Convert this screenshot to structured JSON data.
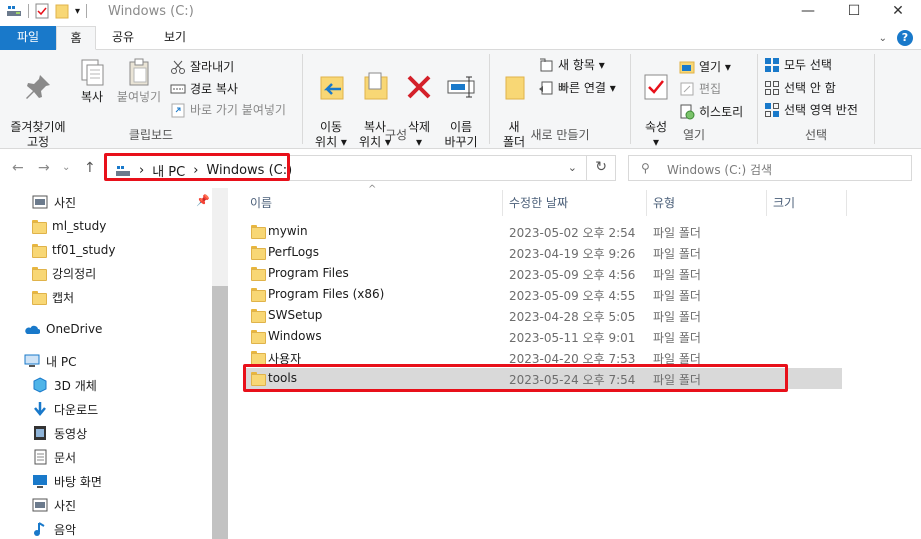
{
  "window": {
    "title": "Windows  (C:)",
    "controls": [
      "—",
      "☐",
      "✕"
    ]
  },
  "ribbon_tabs": [
    "파일",
    "홈",
    "공유",
    "보기"
  ],
  "ribbon": {
    "clipboard": {
      "pin": "즐겨찾기에\n고정",
      "copy": "복사",
      "paste": "붙여넣기",
      "cut": "잘라내기",
      "copy_path": "경로 복사",
      "paste_shortcut": "바로 가기 붙여넣기",
      "label": "클립보드"
    },
    "organize": {
      "move_to": "이동\n위치 ▾",
      "copy_to": "복사\n위치 ▾",
      "delete": "삭제\n▾",
      "rename": "이름\n바꾸기",
      "label": "구성"
    },
    "new": {
      "new_folder": "새\n폴더",
      "new_item": "새 항목 ▾",
      "easy_access": "빠른 연결 ▾",
      "label": "새로 만들기"
    },
    "open": {
      "properties": "속성\n▾",
      "open": "열기 ▾",
      "edit": "편집",
      "history": "히스토리",
      "label": "열기"
    },
    "select": {
      "select_all": "모두 선택",
      "select_none": "선택 안 함",
      "invert": "선택 영역 반전",
      "label": "선택"
    }
  },
  "address": {
    "crumbs": [
      "내 PC",
      "Windows  (C:)"
    ],
    "search_placeholder": "Windows  (C:) 검색"
  },
  "nav_pane": {
    "quick_access": [
      "사진",
      "ml_study",
      "tf01_study",
      "강의정리",
      "캡처"
    ],
    "onedrive": "OneDrive",
    "this_pc": "내 PC",
    "pc_items": [
      "3D 개체",
      "다운로드",
      "동영상",
      "문서",
      "바탕 화면",
      "사진",
      "음악"
    ]
  },
  "columns": {
    "name": "이름",
    "modified": "수정한 날짜",
    "type": "유형",
    "size": "크기"
  },
  "files": [
    {
      "name": "mywin",
      "date": "2023-05-02 오후 2:54",
      "type": "파일 폴더"
    },
    {
      "name": "PerfLogs",
      "date": "2023-04-19 오후 9:26",
      "type": "파일 폴더"
    },
    {
      "name": "Program Files",
      "date": "2023-05-09 오후 4:56",
      "type": "파일 폴더"
    },
    {
      "name": "Program Files (x86)",
      "date": "2023-05-09 오후 4:55",
      "type": "파일 폴더"
    },
    {
      "name": "SWSetup",
      "date": "2023-04-28 오후 5:05",
      "type": "파일 폴더"
    },
    {
      "name": "Windows",
      "date": "2023-05-11 오후 9:01",
      "type": "파일 폴더"
    },
    {
      "name": "사용자",
      "date": "2023-04-20 오후 7:53",
      "type": "파일 폴더"
    },
    {
      "name": "tools",
      "date": "2023-05-24 오후 7:54",
      "type": "파일 폴더"
    }
  ],
  "selected_file": "tools",
  "colors": {
    "accent": "#1979ca",
    "highlight": "#e8101a",
    "selection": "#d9d9d9"
  }
}
